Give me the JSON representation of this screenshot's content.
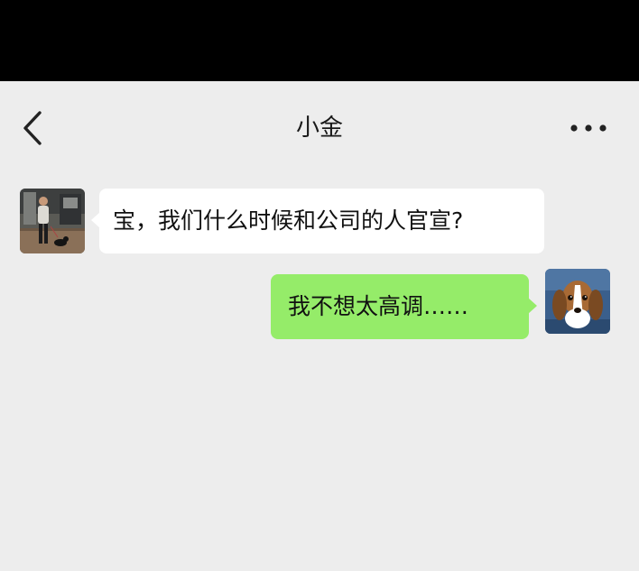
{
  "header": {
    "title": "小金",
    "back_icon": "chevron-left-icon",
    "more_icon": "more-dots-icon"
  },
  "messages": [
    {
      "side": "left",
      "text": "宝，我们什么时候和公司的人官宣?",
      "avatar": "person-walking-dog-photo"
    },
    {
      "side": "right",
      "text": "我不想太高调……",
      "avatar": "beagle-dog-photo"
    }
  ],
  "colors": {
    "status_bar": "#000000",
    "background": "#ededed",
    "incoming_bubble": "#ffffff",
    "outgoing_bubble": "#95ec69",
    "text": "#111111"
  }
}
